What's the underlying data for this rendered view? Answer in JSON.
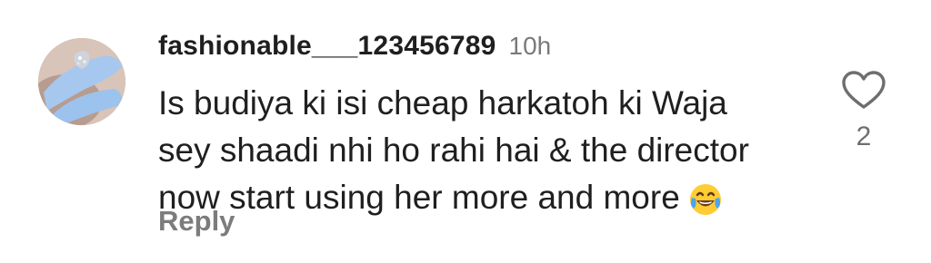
{
  "comment": {
    "username": "fashionable___123456789",
    "timestamp": "10h",
    "text_lines": [
      "Is budiya ki isi cheap harkatoh ki Waja",
      "sey shaadi nhi ho rahi hai & the director",
      "now start using her more and more"
    ],
    "emoji": "face-with-tears-of-joy",
    "reply_label": "Reply",
    "like_count": "2"
  },
  "colors": {
    "text": "#1f1f1f",
    "muted": "#7a7a7a",
    "icon": "#6e6e6e",
    "emoji_face": "#ffcc33"
  }
}
